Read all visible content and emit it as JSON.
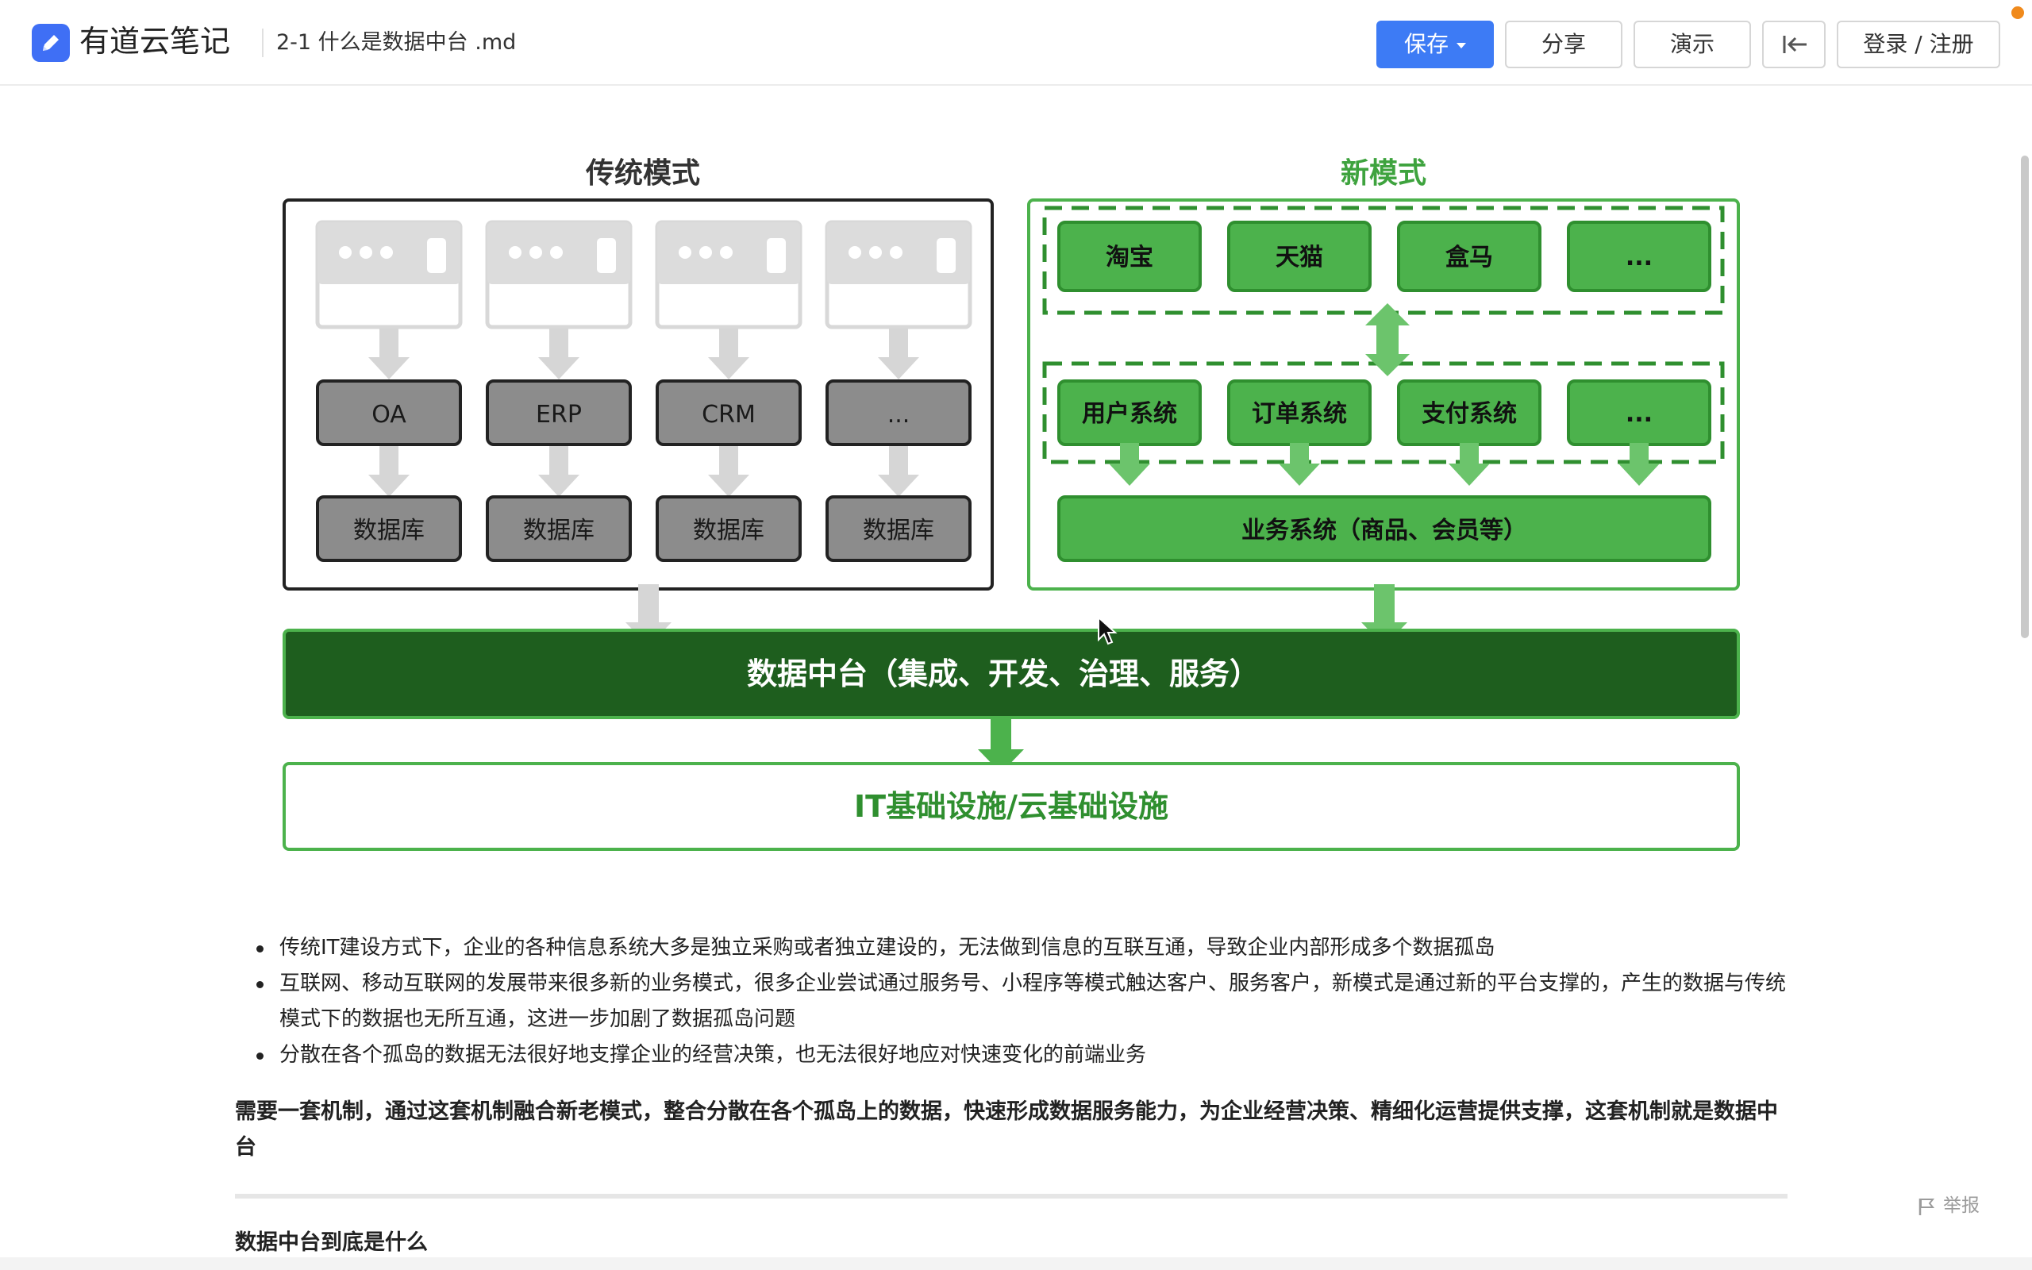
{
  "app": {
    "name": "有道云笔记"
  },
  "document": {
    "title": "2-1 什么是数据中台 .md"
  },
  "toolbar": {
    "save_label": "保存",
    "share_label": "分享",
    "present_label": "演示",
    "login_label": "登录 / 注册"
  },
  "diagram": {
    "traditional": {
      "title": "传统模式",
      "systems": [
        "OA",
        "ERP",
        "CRM",
        "..."
      ],
      "databases": [
        "数据库",
        "数据库",
        "数据库",
        "数据库"
      ]
    },
    "new_mode": {
      "title": "新模式",
      "apps": [
        "淘宝",
        "天猫",
        "盒马",
        "..."
      ],
      "systems": [
        "用户系统",
        "订单系统",
        "支付系统",
        "..."
      ],
      "business": "业务系统（商品、会员等）"
    },
    "middle_platform": "数据中台（集成、开发、治理、服务）",
    "infrastructure": "IT基础设施/云基础设施",
    "colors": {
      "green": "#4cb24c",
      "green_border": "#2f8f2f",
      "dark_green": "#1e5e1e",
      "gray_box": "#8c8c8c",
      "light_gray": "#dcdcdc"
    }
  },
  "content": {
    "bullets": [
      "传统IT建设方式下，企业的各种信息系统大多是独立采购或者独立建设的，无法做到信息的互联互通，导致企业内部形成多个数据孤岛",
      "互联网、移动互联网的发展带来很多新的业务模式，很多企业尝试通过服务号、小程序等模式触达客户、服务客户，新模式是通过新的平台支撑的，产生的数据与传统模式下的数据也无所互通，这进一步加剧了数据孤岛问题",
      "分散在各个孤岛的数据无法很好地支撑企业的经营决策，也无法很好地应对快速变化的前端业务"
    ],
    "bold_paragraph": "需要一套机制，通过这套机制融合新老模式，整合分散在各个孤岛上的数据，快速形成数据服务能力，为企业经营决策、精细化运营提供支撑，这套机制就是数据中台",
    "next_heading": "数据中台到底是什么"
  },
  "footer": {
    "report_label": "举报"
  }
}
